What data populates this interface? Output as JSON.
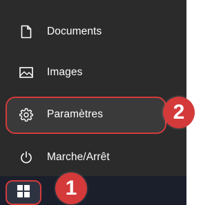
{
  "menu": {
    "items": [
      {
        "label": "Documents",
        "icon": "document-icon"
      },
      {
        "label": "Images",
        "icon": "image-icon"
      },
      {
        "label": "Paramètres",
        "icon": "gear-icon"
      },
      {
        "label": "Marche/Arrêt",
        "icon": "power-icon"
      }
    ]
  },
  "taskbar": {
    "start_icon": "windows-logo-icon"
  },
  "annotations": {
    "step_1": "1",
    "step_2": "2"
  },
  "colors": {
    "menu_background": "#2b2b2b",
    "taskbar_background": "#1b1f2b",
    "highlight_red": "#d43a3a",
    "text": "#ffffff"
  }
}
